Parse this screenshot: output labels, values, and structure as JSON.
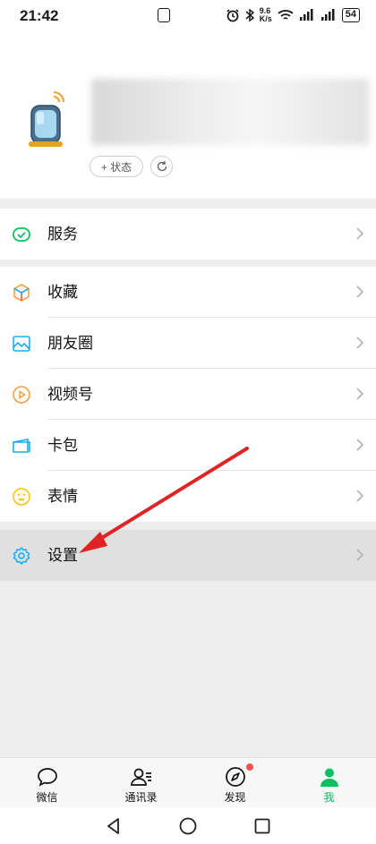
{
  "status_bar": {
    "time": "21:42",
    "net_speed_top": "9.6",
    "net_speed_bottom": "K/s",
    "battery": "54"
  },
  "profile": {
    "status_button_label": "+ 状态"
  },
  "menu_services": [
    {
      "label": "服务",
      "icon": "wallet-check-icon"
    }
  ],
  "menu_main": [
    {
      "label": "收藏",
      "icon": "favorites-cube-icon"
    },
    {
      "label": "朋友圈",
      "icon": "moments-photo-icon"
    },
    {
      "label": "视频号",
      "icon": "channels-play-icon"
    },
    {
      "label": "卡包",
      "icon": "card-wallet-icon"
    },
    {
      "label": "表情",
      "icon": "emoji-smile-icon"
    }
  ],
  "menu_settings": [
    {
      "label": "设置",
      "icon": "gear-icon"
    }
  ],
  "tabbar": [
    {
      "label": "微信",
      "icon": "chat-bubble-icon"
    },
    {
      "label": "通讯录",
      "icon": "contacts-icon"
    },
    {
      "label": "发现",
      "icon": "compass-icon"
    },
    {
      "label": "我",
      "icon": "person-icon"
    }
  ],
  "colors": {
    "accent_green": "#07c160",
    "annotation_red": "#e02424",
    "badge_red": "#fa5151"
  }
}
